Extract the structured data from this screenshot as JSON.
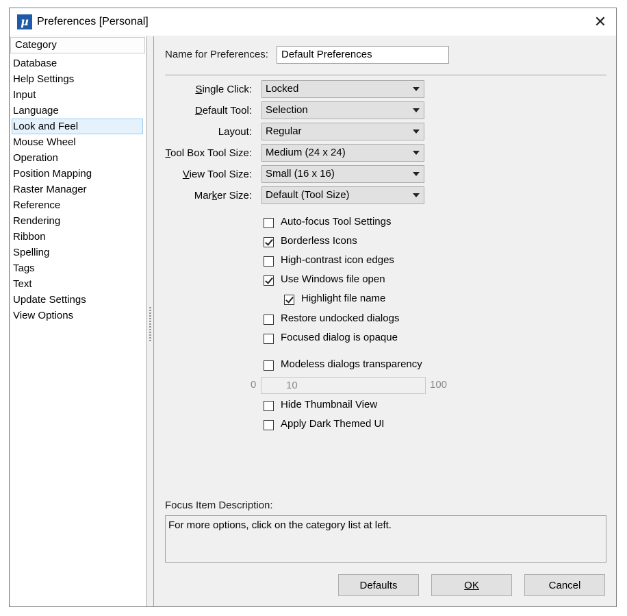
{
  "window": {
    "title": "Preferences [Personal]",
    "app_icon_glyph": "µ",
    "close_glyph": "✕"
  },
  "category": {
    "header": "Category",
    "items": [
      {
        "label": "Database"
      },
      {
        "label": "Help Settings"
      },
      {
        "label": "Input"
      },
      {
        "label": "Language"
      },
      {
        "label": "Look and Feel",
        "selected": true
      },
      {
        "label": "Mouse Wheel"
      },
      {
        "label": "Operation"
      },
      {
        "label": "Position Mapping"
      },
      {
        "label": "Raster Manager"
      },
      {
        "label": "Reference"
      },
      {
        "label": "Rendering"
      },
      {
        "label": "Ribbon"
      },
      {
        "label": "Spelling"
      },
      {
        "label": "Tags"
      },
      {
        "label": "Text"
      },
      {
        "label": "Update Settings"
      },
      {
        "label": "View Options"
      }
    ]
  },
  "name_field": {
    "label": "Name for Preferences:",
    "value": "Default Preferences"
  },
  "fields": {
    "single_click": {
      "label": "Single Click:",
      "value": "Locked"
    },
    "default_tool": {
      "label": "Default Tool:",
      "value": "Selection"
    },
    "layout": {
      "label": "Layout:",
      "value": "Regular"
    },
    "tool_box_tool_size": {
      "label": "Tool Box Tool Size:",
      "value": "Medium (24 x 24)"
    },
    "view_tool_size": {
      "label": "View Tool Size:",
      "value": "Small (16 x 16)"
    },
    "marker_size": {
      "label": "Marker Size:",
      "value": "Default (Tool Size)"
    }
  },
  "checkboxes": {
    "auto_focus": {
      "label": "Auto-focus Tool Settings",
      "checked": false
    },
    "borderless_icons": {
      "label": "Borderless Icons",
      "checked": true
    },
    "high_contrast": {
      "label": "High-contrast icon edges",
      "checked": false
    },
    "windows_file_open": {
      "label": "Use Windows file open",
      "checked": true
    },
    "highlight_file_name": {
      "label": "Highlight file name",
      "checked": true
    },
    "restore_undocked": {
      "label": "Restore undocked dialogs",
      "checked": false
    },
    "focused_opaque": {
      "label": "Focused dialog is opaque",
      "checked": false
    },
    "modeless_transparency": {
      "label": "Modeless dialogs transparency",
      "checked": false
    },
    "hide_thumbnail": {
      "label": "Hide Thumbnail View",
      "checked": false
    },
    "dark_theme": {
      "label": "Apply Dark Themed UI",
      "checked": false
    }
  },
  "transparency": {
    "min": "0",
    "value": "10",
    "max": "100"
  },
  "description": {
    "label": "Focus Item Description:",
    "text": "For more options, click on the category list at left."
  },
  "buttons": {
    "defaults": "Defaults",
    "ok": "OK",
    "cancel": "Cancel"
  }
}
